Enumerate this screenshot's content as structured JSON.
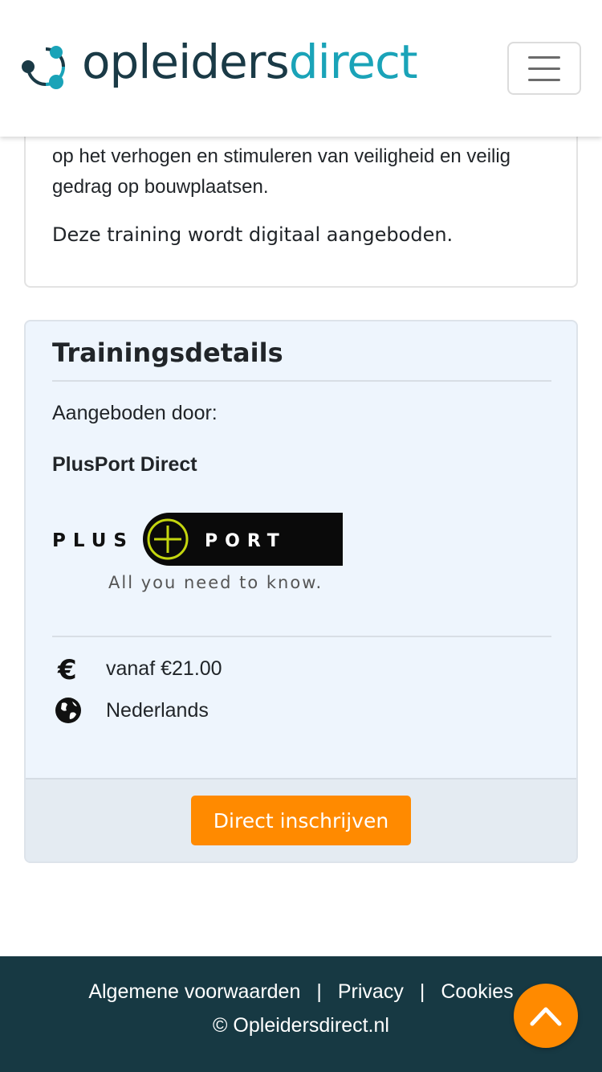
{
  "header": {
    "logo_part1": "opleiders",
    "logo_part2": "direct",
    "menu_icon": "hamburger-icon"
  },
  "description": {
    "text": "op het verhogen en stimuleren van veiligheid en veilig gedrag op bouwplaatsen.",
    "note": "Deze training wordt digitaal aangeboden."
  },
  "details": {
    "title": "Trainingsdetails",
    "offered_by_label": "Aangeboden door:",
    "provider_name": "PlusPort Direct",
    "provider_logo": {
      "left_text": "PLUS",
      "right_text": "PORT",
      "tagline": "All you need to know."
    },
    "price": {
      "icon": "euro-icon",
      "text": "vanaf €21.00"
    },
    "language": {
      "icon": "globe-icon",
      "text": "Nederlands"
    },
    "enroll_button": "Direct inschrijven"
  },
  "footer": {
    "links": [
      "Algemene voorwaarden",
      "Privacy",
      "Cookies"
    ],
    "separator": "|",
    "copyright": "© Opleidersdirect.nl"
  },
  "scroll_top_icon": "chevron-up-icon",
  "colors": {
    "brand_dark": "#1a3a46",
    "brand_teal": "#1aa3b8",
    "accent_orange": "#ff8a00",
    "footer_bg": "#173943",
    "card_bg": "#eef5fd"
  }
}
